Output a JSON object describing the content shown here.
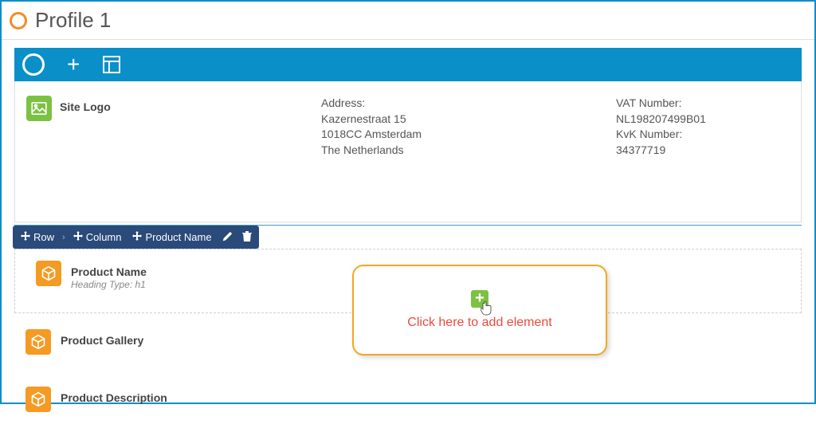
{
  "header": {
    "title": "Profile 1"
  },
  "logo": {
    "label": "Site Logo"
  },
  "address": {
    "label": "Address:",
    "line1": "Kazernestraat 15",
    "line2": "1018CC Amsterdam",
    "line3": "The Netherlands"
  },
  "vat": {
    "vat_label": "VAT Number:",
    "vat_value": "NL198207499B01",
    "kvk_label": "KvK Number:",
    "kvk_value": "34377719"
  },
  "breadcrumb": {
    "row": "Row",
    "column": "Column",
    "element": "Product Name"
  },
  "elements": {
    "product_name": {
      "title": "Product Name",
      "sub": "Heading Type: h1"
    },
    "product_gallery": {
      "title": "Product Gallery"
    },
    "product_description": {
      "title": "Product Description"
    }
  },
  "callout": {
    "text": "Click here to add element"
  }
}
